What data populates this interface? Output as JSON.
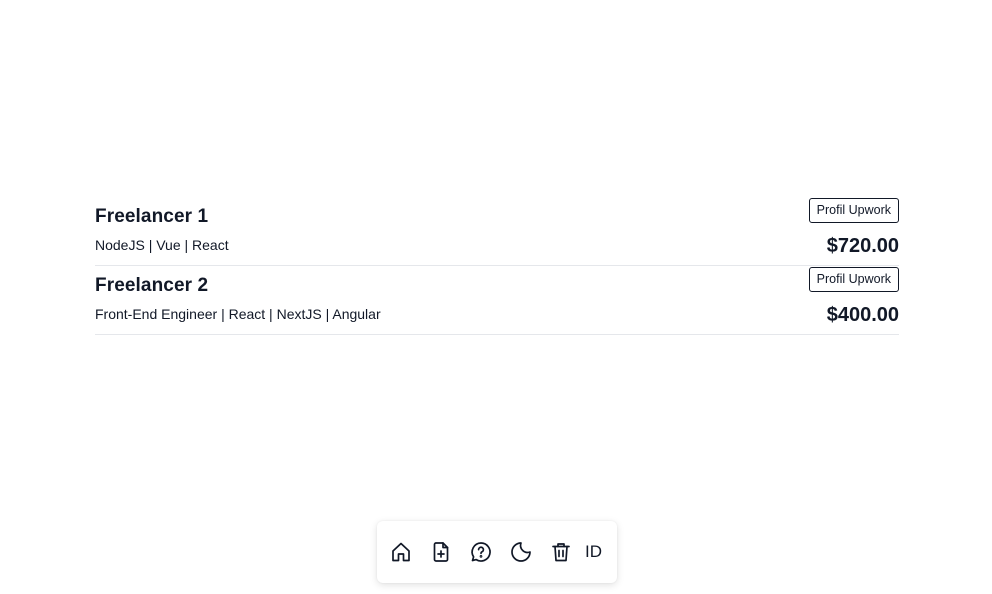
{
  "freelancers": [
    {
      "name": "Freelancer 1",
      "skills": "NodeJS | Vue | React",
      "profile_label": "Profil Upwork",
      "price": "$720.00"
    },
    {
      "name": "Freelancer 2",
      "skills": "Front-End Engineer | React | NextJS | Angular",
      "profile_label": "Profil Upwork",
      "price": "$400.00"
    }
  ],
  "dock": {
    "icons": [
      "home-icon",
      "file-plus-icon",
      "help-chat-icon",
      "moon-icon",
      "trash-icon"
    ],
    "language": "ID"
  }
}
